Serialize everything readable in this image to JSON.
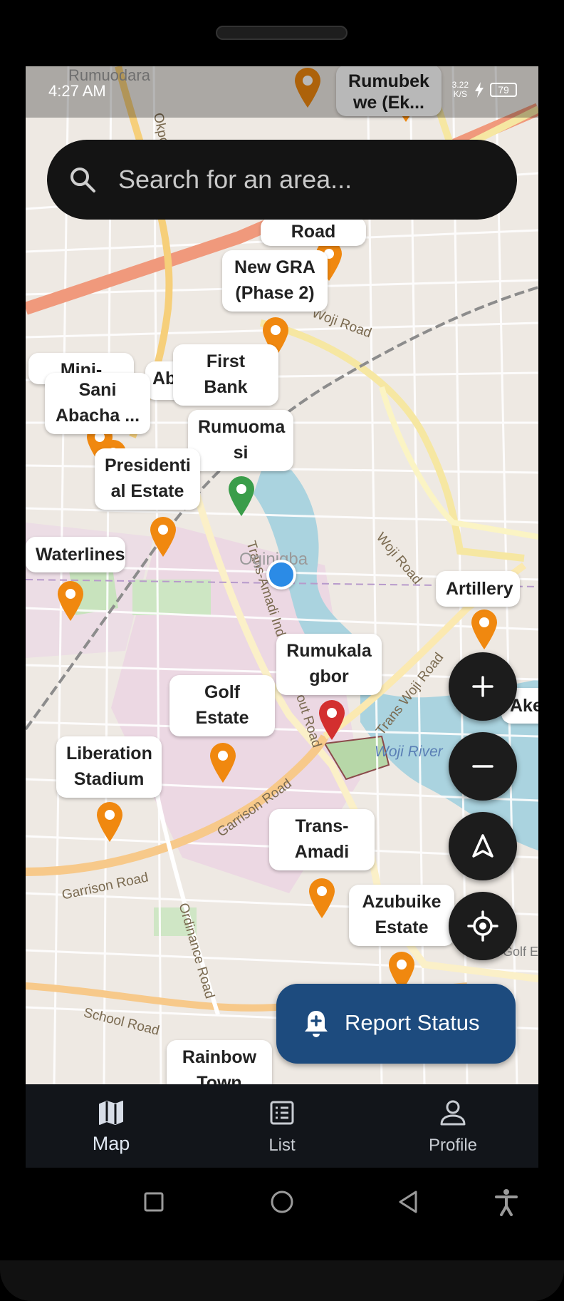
{
  "status_bar": {
    "time": "4:27 AM",
    "speed": "3.22",
    "speed_unit": "K/S",
    "battery": "79"
  },
  "search": {
    "placeholder": "Search for an area..."
  },
  "street_labels": [
    "Okporo Road",
    "Woji Road",
    "Woji Road",
    "Trans Woji Road",
    "Trans-Amadi Industrial Layout Road",
    "Garrison Road",
    "Garrison Road",
    "Ordinance Road",
    "School Road",
    "Woji River",
    "Oginigba",
    "Rumuodara",
    "Golf E"
  ],
  "place_labels": [
    "Rumubek\nwe (Ek...",
    "Road",
    "New GRA\n(Phase 2)",
    "First Bank\n(Rumuo...",
    "Mini-",
    "Ab",
    "Sani\nAbacha ...",
    "Rumuoma\nsi",
    "Presidenti\nal Estate",
    "Waterlines",
    "Artillery",
    "Rumukala\ngbor",
    "Ake",
    "Golf\nEstate",
    "Liberation\nStadium",
    "Trans-\nAmadi In...",
    "Azubuike\nEstate",
    "Rainbow\nTown"
  ],
  "map_controls": {
    "zoom_in": "zoom-in",
    "zoom_out": "zoom-out",
    "compass": "navigation",
    "locate": "my-location"
  },
  "report_button": {
    "label": "Report Status"
  },
  "bottom_nav": [
    {
      "label": "Map",
      "icon": "map-icon",
      "active": true
    },
    {
      "label": "List",
      "icon": "list-icon",
      "active": false
    },
    {
      "label": "Profile",
      "icon": "person-icon",
      "active": false
    }
  ],
  "colors": {
    "pin_orange": "#f0880f",
    "pin_red": "#d32f2f",
    "pin_green": "#3a9d4a",
    "user_dot": "#2b8be6",
    "report_bg": "#1d4b7e"
  }
}
